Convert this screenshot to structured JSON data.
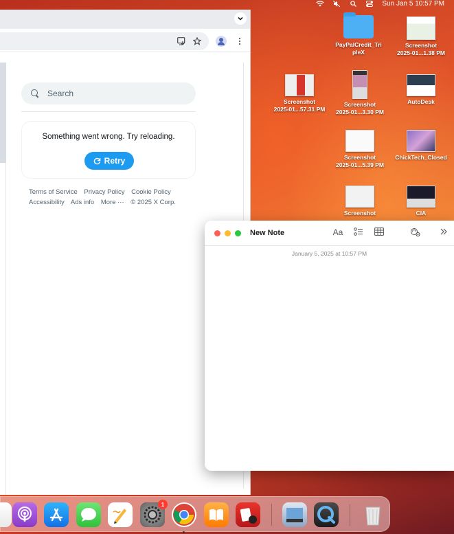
{
  "menubar": {
    "datetime": "Sun Jan 5  10:57 PM"
  },
  "browser": {
    "search_placeholder": "Search",
    "error_message": "Something went wrong. Try reloading.",
    "retry_label": "Retry",
    "footer_links": [
      "Terms of Service",
      "Privacy Policy",
      "Cookie Policy",
      "Accessibility",
      "Ads info",
      "More ···",
      "© 2025 X Corp."
    ]
  },
  "desktop_icons": [
    {
      "name": "PayPalCredit_Tri\npleX",
      "label1": "PayPalCredit_Tri",
      "label2": "pleX"
    },
    {
      "label1": "Screenshot",
      "label2": "2025-01...1.38 PM"
    },
    {
      "label1": "Screenshot",
      "label2": "2025-01...57.31 PM"
    },
    {
      "label1": "Screenshot",
      "label2": "2025-01...3.30 PM"
    },
    {
      "label1": "AutoDesk",
      "label2": ""
    },
    {
      "label1": "Screenshot",
      "label2": "2025-01...5.39 PM"
    },
    {
      "label1": "ChickTech_Closed",
      "label2": ""
    },
    {
      "label1": "Screenshot",
      "label2": ""
    },
    {
      "label1": "CIA",
      "label2": ""
    }
  ],
  "notes": {
    "title": "New Note",
    "date": "January 5, 2025 at 10:57 PM",
    "format_label": "Aa"
  },
  "dock": {
    "settings_badge": "1"
  },
  "colors": {
    "accent_blue": "#1d9bf0",
    "traffic_red": "#ff5f57",
    "traffic_yellow": "#febc2e",
    "traffic_green": "#28c840"
  }
}
